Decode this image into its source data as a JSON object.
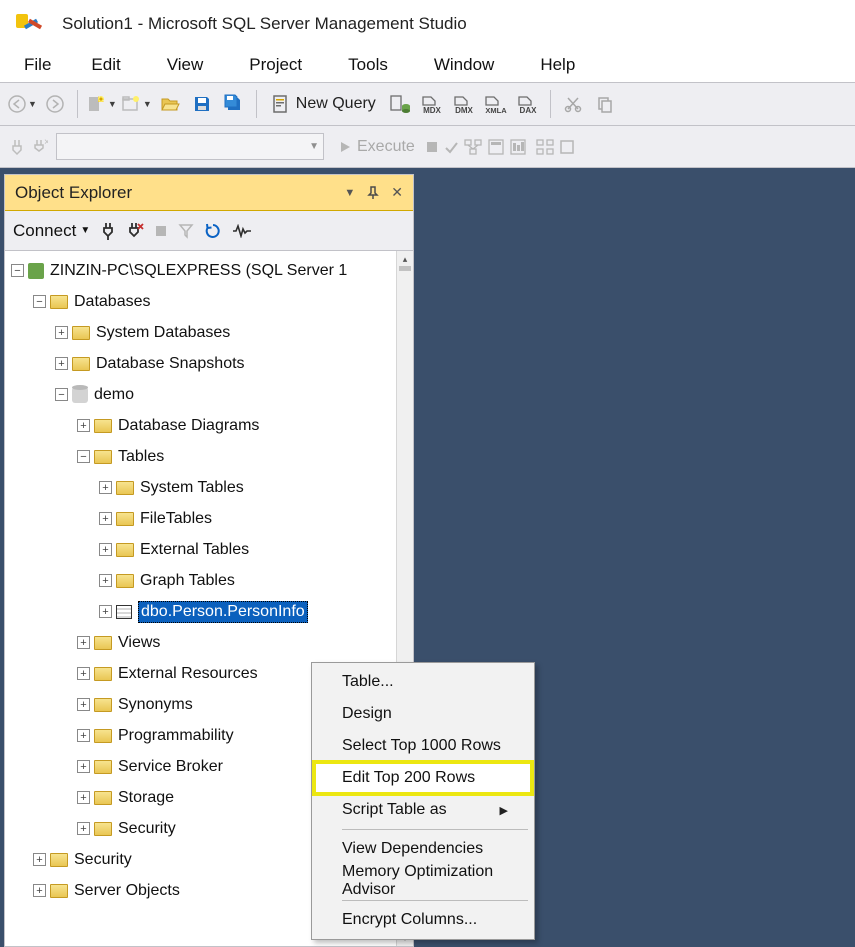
{
  "title": "Solution1 - Microsoft SQL Server Management Studio",
  "menu": {
    "file": "File",
    "edit": "Edit",
    "view": "View",
    "project": "Project",
    "tools": "Tools",
    "window": "Window",
    "help": "Help"
  },
  "toolbar": {
    "new_query": "New Query",
    "execute": "Execute"
  },
  "oe": {
    "title": "Object Explorer",
    "connect": "Connect",
    "tree": {
      "server": "ZINZIN-PC\\SQLEXPRESS (SQL Server 1",
      "databases": "Databases",
      "system_databases": "System Databases",
      "database_snapshots": "Database Snapshots",
      "demo": "demo",
      "database_diagrams": "Database Diagrams",
      "tables": "Tables",
      "system_tables": "System Tables",
      "filetables": "FileTables",
      "external_tables": "External Tables",
      "graph_tables": "Graph Tables",
      "table_person": "dbo.Person.PersonInfo",
      "views": "Views",
      "external_resources": "External Resources",
      "synonyms": "Synonyms",
      "programmability": "Programmability",
      "service_broker": "Service Broker",
      "storage": "Storage",
      "security_inner": "Security",
      "security": "Security",
      "server_objects": "Server Objects"
    }
  },
  "context_menu": {
    "table": "Table...",
    "design": "Design",
    "select_top": "Select Top 1000 Rows",
    "edit_top": "Edit Top 200 Rows",
    "script_as": "Script Table as",
    "view_deps": "View Dependencies",
    "mem_opt": "Memory Optimization Advisor",
    "encrypt": "Encrypt Columns..."
  }
}
